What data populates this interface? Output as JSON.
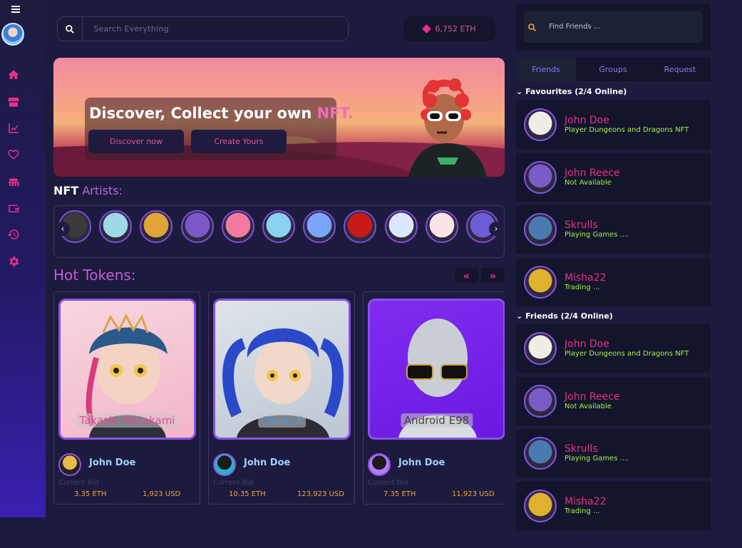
{
  "topbar": {
    "search_placeholder": "Search Everything",
    "balance": "6,752 ETH"
  },
  "hero": {
    "title_main": "Discover, Collect your own ",
    "title_accent": "NFT.",
    "discover_button": "Discover now",
    "create_button": "Create Yours"
  },
  "artists": {
    "title_main": "NFT",
    "title_accent": " Artists:",
    "count": 11
  },
  "hot_tokens": {
    "title": "Hot Tokens:",
    "prev": "«",
    "next": "»",
    "cards": [
      {
        "name": "Takashi Murakami",
        "owner": "John Doe",
        "bid_label": "Current Bid",
        "eth": "3.35 ETH",
        "usd": "1,923 USD"
      },
      {
        "name": "Clone X",
        "owner": "John Doe",
        "bid_label": "Current Bid",
        "eth": "10.35 ETH",
        "usd": "123,923 USD"
      },
      {
        "name": "Android E98",
        "owner": "John Doe",
        "bid_label": "Current Bid",
        "eth": "7.35 ETH",
        "usd": "11,923 USD"
      }
    ]
  },
  "right_panel": {
    "search_placeholder": "Find Friends ...",
    "tabs": [
      "Friends",
      "Groups",
      "Request"
    ],
    "favourites_title": "Favourites (2/4 Online)",
    "friends_title": "Friends (2/4 Online)",
    "favourites": [
      {
        "name": "John Doe",
        "status": "Player Dungeons and Dragons NFT"
      },
      {
        "name": "John Reece",
        "status": "Not Available"
      },
      {
        "name": "Skrulls",
        "status": "Playing Games ...."
      },
      {
        "name": "Misha22",
        "status": "Trading ..."
      }
    ],
    "friends": [
      {
        "name": "John Doe",
        "status": "Player Dungeons and Dragons NFT"
      },
      {
        "name": "John Reece",
        "status": "Not Available"
      },
      {
        "name": "Skrulls",
        "status": "Playing Games ...."
      },
      {
        "name": "Misha22",
        "status": "Trading ..."
      }
    ]
  },
  "colors": {
    "accent_pink": "#e8308a",
    "accent_purple": "#8a52ea",
    "status_green": "#a8f04a",
    "price_orange": "#f0a040"
  },
  "sidebar_icons": [
    "home-icon",
    "store-icon",
    "chart-icon",
    "heart-icon",
    "collection-icon",
    "wallet-icon",
    "history-icon",
    "settings-icon"
  ]
}
